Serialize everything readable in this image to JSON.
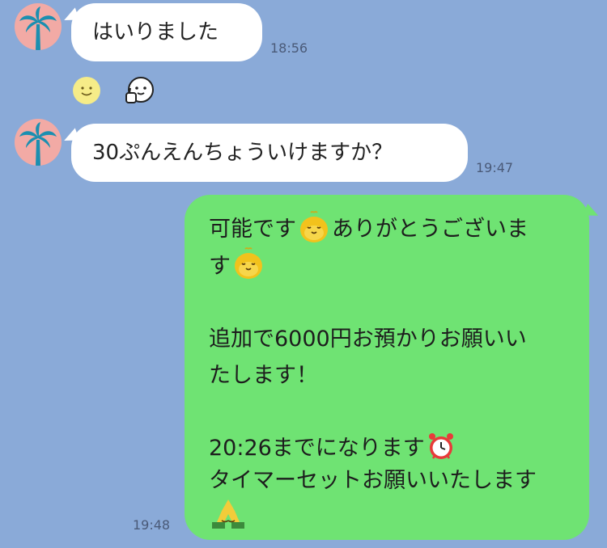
{
  "messages": [
    {
      "sender": "other",
      "text": "はいりました",
      "time": "18:56"
    },
    {
      "sender": "other",
      "text": "30ぷんえんちょういけますか？",
      "time": "19:47"
    },
    {
      "sender": "me",
      "lines": [
        "可能です",
        "ありがとうございま",
        "す",
        "追加で6000円お預かりお願いい",
        "たします！",
        "20:26までになります",
        "タイマーセットお願いいたします"
      ],
      "time": "19:48"
    }
  ],
  "reactions": [
    "smile-face-icon",
    "thumbs-up-face-icon"
  ],
  "emoji": [
    "bird-emoji-icon",
    "alarm-clock-icon",
    "praying-hands-icon"
  ],
  "colors": {
    "background": "#8aaad8",
    "incoming_bubble": "#ffffff",
    "outgoing_bubble": "#6fe373",
    "avatar_bg": "#f2aaa5",
    "palm": "#1b8fb0"
  }
}
